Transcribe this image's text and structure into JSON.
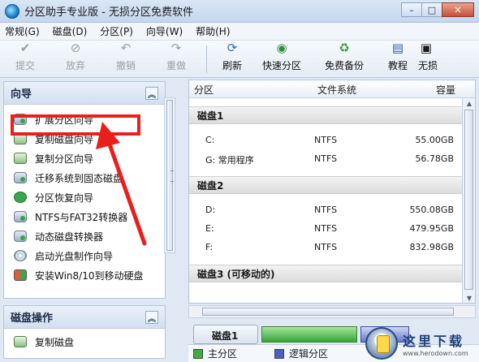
{
  "window": {
    "title": "分区助手专业版 - 无损分区免费软件",
    "minimize": "–",
    "maximize": "□",
    "close": "✕"
  },
  "menu": [
    "常规(G)",
    "磁盘(D)",
    "分区(P)",
    "向导(W)",
    "帮助(H)"
  ],
  "toolbar": {
    "submit": "提交",
    "discard": "放弃",
    "undo": "撤销",
    "redo": "重做",
    "refresh": "刷新",
    "quick_partition": "快速分区",
    "free_backup": "免费备份",
    "tutorial": "教程",
    "lossless": "无损"
  },
  "wizard_panel": {
    "title": "向导",
    "items": [
      "扩展分区向导",
      "复制磁盘向导",
      "复制分区向导",
      "迁移系统到固态磁盘",
      "分区恢复向导",
      "NTFS与FAT32转换器",
      "动态磁盘转换器",
      "启动光盘制作向导",
      "安装Win8/10到移动硬盘"
    ]
  },
  "disk_ops_panel": {
    "title": "磁盘操作",
    "items": [
      "复制磁盘"
    ]
  },
  "table": {
    "headers": {
      "partition": "分区",
      "filesystem": "文件系统",
      "capacity": "容量"
    },
    "disks": [
      {
        "name": "磁盘1",
        "partitions": [
          {
            "name": "C:",
            "fs": "NTFS",
            "cap": "55.00GB"
          },
          {
            "name": "G: 常用程序",
            "fs": "NTFS",
            "cap": "56.78GB"
          }
        ]
      },
      {
        "name": "磁盘2",
        "partitions": [
          {
            "name": "D:",
            "fs": "NTFS",
            "cap": "550.08GB"
          },
          {
            "name": "E:",
            "fs": "NTFS",
            "cap": "479.95GB"
          },
          {
            "name": "F:",
            "fs": "NTFS",
            "cap": "832.98GB"
          }
        ]
      },
      {
        "name": "磁盘3 (可移动的)",
        "partitions": []
      }
    ]
  },
  "diskmap": {
    "label": "磁盘1"
  },
  "legend": {
    "primary": "主分区",
    "logical": "逻辑分区"
  },
  "watermark": {
    "text": "这里下载",
    "url": "www.herodown.com"
  },
  "colors": {
    "highlight": "#e8201b",
    "primary": "#3fae40",
    "logical": "#4b60c6"
  }
}
